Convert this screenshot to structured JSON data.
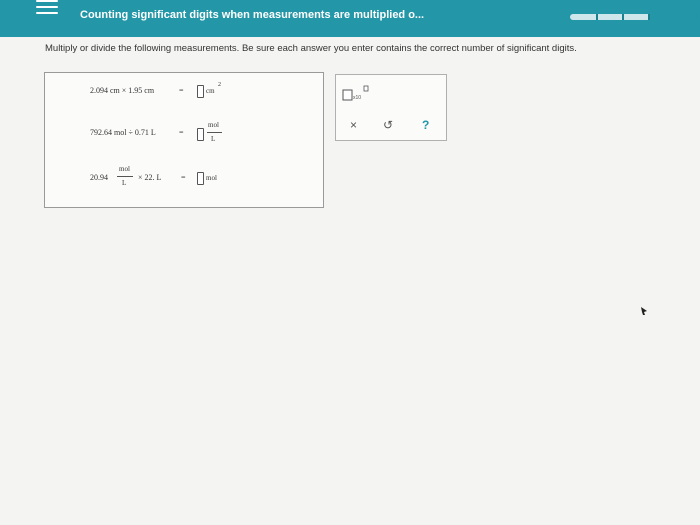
{
  "header": {
    "title": "Counting significant digits when measurements are multiplied o...",
    "progress_fraction": 0.6
  },
  "prompt": "Multiply or divide the following measurements. Be sure each answer you enter contains the correct number of significant digits.",
  "problems": [
    {
      "left": "2.094 cm × 1.95 cm",
      "equals": "=",
      "unit": "cm",
      "exponent": "2",
      "answer": ""
    },
    {
      "left": "792.64 mol ÷ 0.71 L",
      "equals": "=",
      "unit_num": "mol",
      "unit_den": "L",
      "answer": ""
    },
    {
      "coef": "20.94",
      "frac_num": "mol",
      "frac_den": "L",
      "tail": "× 22. L",
      "equals": "=",
      "unit": "mol",
      "answer": ""
    }
  ],
  "tools": {
    "sci_notation_digit": "×10",
    "clear_symbol": "×",
    "undo_symbol": "↺",
    "help_symbol": "?"
  },
  "colors": {
    "header_bg": "#2397a8",
    "accent": "#2397a8",
    "help": "#2397a8"
  }
}
